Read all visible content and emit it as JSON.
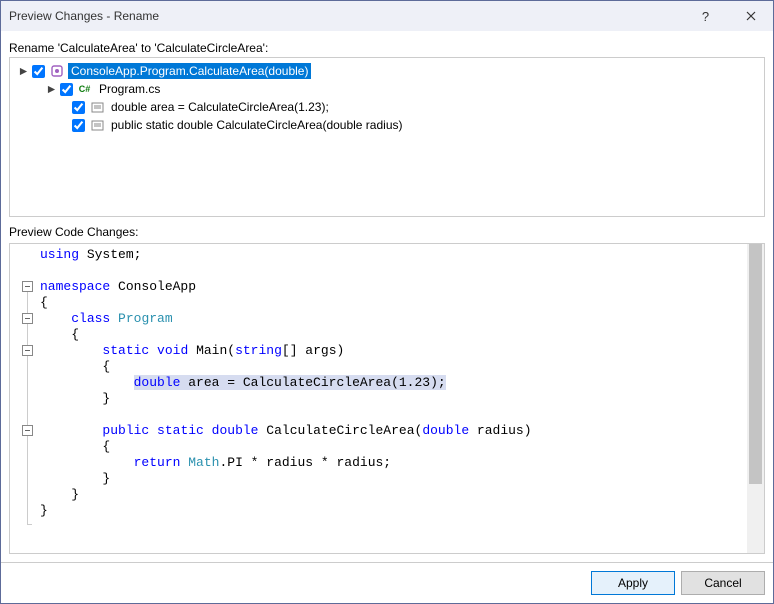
{
  "window": {
    "title": "Preview Changes - Rename"
  },
  "header": {
    "rename_label": "Rename 'CalculateArea' to 'CalculateCircleArea':"
  },
  "tree": {
    "root": "ConsoleApp.Program.CalculateArea(double)",
    "file": "Program.cs",
    "ref1": "double area = CalculateCircleArea(1.23);",
    "ref2": "public static double CalculateCircleArea(double radius)"
  },
  "code_section": {
    "label": "Preview Code Changes:"
  },
  "code": {
    "kw_using": "using",
    "sys": " System;",
    "kw_namespace": "namespace",
    "ns": " ConsoleApp",
    "ob1": "{",
    "kw_class": "class",
    "ty_program": "Program",
    "ob2": "{",
    "kw_static": "static",
    "kw_void": "void",
    "main": " Main(",
    "kw_string": "string",
    "main2": "[] args)",
    "ob3": "{",
    "kw_double": "double",
    "area_assign": " area = CalculateCircleArea(1.23);",
    "cb3": "}",
    "kw_public": "public",
    "sig1": " CalculateCircleArea(",
    "sig2": " radius)",
    "ob4": "{",
    "kw_return": "return",
    "ty_math": "Math",
    "ret": ".PI * radius * radius;",
    "cb4": "}",
    "cb2": "}",
    "cb1": "}"
  },
  "footer": {
    "apply": "Apply",
    "cancel": "Cancel"
  }
}
